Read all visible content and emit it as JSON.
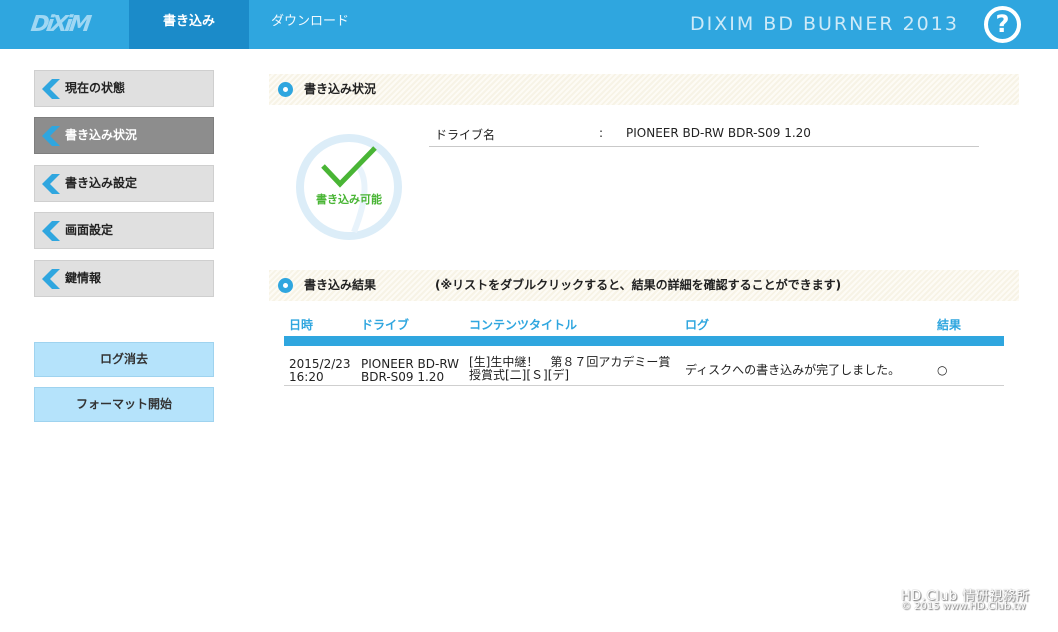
{
  "header": {
    "logo": "DiXiM",
    "tabs": [
      {
        "label": "書き込み",
        "active": true
      },
      {
        "label": "ダウンロード",
        "active": false
      }
    ],
    "app_title": "DIXIM BD BURNER 2013",
    "help_label": "?",
    "colors": {
      "bar": "#2fa6df",
      "active_tab": "#1b8bc9"
    }
  },
  "sidebar": {
    "items": [
      {
        "label": "現在の状態",
        "active": false
      },
      {
        "label": "書き込み状況",
        "active": true
      },
      {
        "label": "書き込み設定",
        "active": false
      },
      {
        "label": "画面設定",
        "active": false
      },
      {
        "label": "鍵情報",
        "active": false
      }
    ],
    "buttons": [
      {
        "label": "ログ消去"
      },
      {
        "label": "フォーマット開始"
      }
    ]
  },
  "status_section": {
    "title": "書き込み状況",
    "status_text": "書き込み可能",
    "status_icon": "check-icon",
    "drive_key": "ドライブ名",
    "separator": ":",
    "drive_value": "PIONEER BD-RW BDR-S09 1.20"
  },
  "result_section": {
    "title": "書き込み結果",
    "note": "(※リストをダブルクリックすると、結果の詳細を確認することができます)",
    "columns": [
      "日時",
      "ドライブ",
      "コンテンツタイトル",
      "ログ",
      "結果"
    ],
    "rows": [
      {
        "date_line1": "2015/2/23",
        "date_line2": "16:20",
        "drive_line1": "PIONEER BD-RW",
        "drive_line2": "BDR-S09 1.20",
        "title_line1": "[生]生中継！　第８７回アカデミー賞",
        "title_line2": "授賞式[二][Ｓ][デ]",
        "log": "ディスクへの書き込みが完了しました。",
        "result": "○"
      }
    ]
  },
  "watermark": {
    "line1": "HD.Club 情研視務所",
    "line2": "© 2015  www.HD.Club.tw"
  }
}
